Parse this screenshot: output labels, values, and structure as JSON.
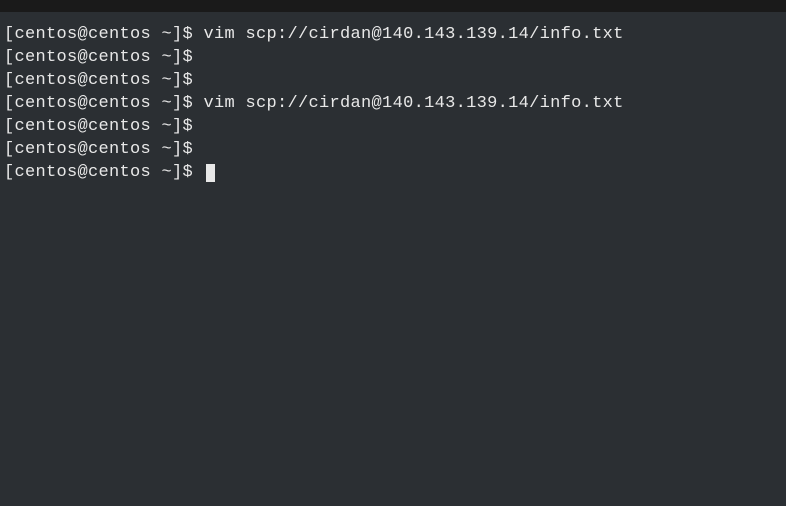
{
  "terminal": {
    "lines": [
      {
        "prompt": "[centos@centos ~]$",
        "command": " vim scp://cirdan@140.143.139.14/info.txt"
      },
      {
        "prompt": "[centos@centos ~]$",
        "command": ""
      },
      {
        "prompt": "[centos@centos ~]$",
        "command": ""
      },
      {
        "prompt": "[centos@centos ~]$",
        "command": " vim scp://cirdan@140.143.139.14/info.txt"
      },
      {
        "prompt": "[centos@centos ~]$",
        "command": ""
      },
      {
        "prompt": "[centos@centos ~]$",
        "command": ""
      },
      {
        "prompt": "[centos@centos ~]$",
        "command": " "
      }
    ]
  }
}
